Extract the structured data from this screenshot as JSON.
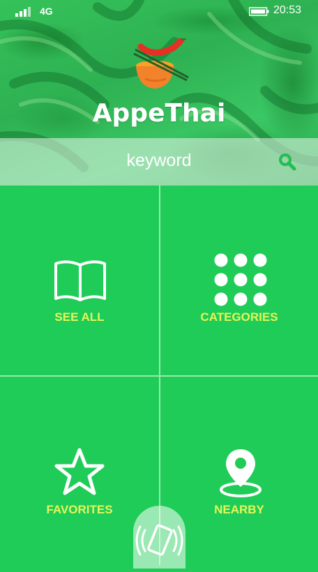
{
  "status_bar": {
    "network": "4G",
    "time": "20:53"
  },
  "app": {
    "name": "AppeThai"
  },
  "search": {
    "placeholder": "keyword"
  },
  "tiles": [
    {
      "label": "SEE ALL",
      "icon": "open-book-icon"
    },
    {
      "label": "CATEGORIES",
      "icon": "dot-grid-icon"
    },
    {
      "label": "FAVORITES",
      "icon": "star-icon"
    },
    {
      "label": "NEARBY",
      "icon": "map-pin-icon"
    }
  ],
  "colors": {
    "accent": "#1fcc57",
    "tile_label": "#e6f65a",
    "search_icon": "#1fbf50"
  }
}
